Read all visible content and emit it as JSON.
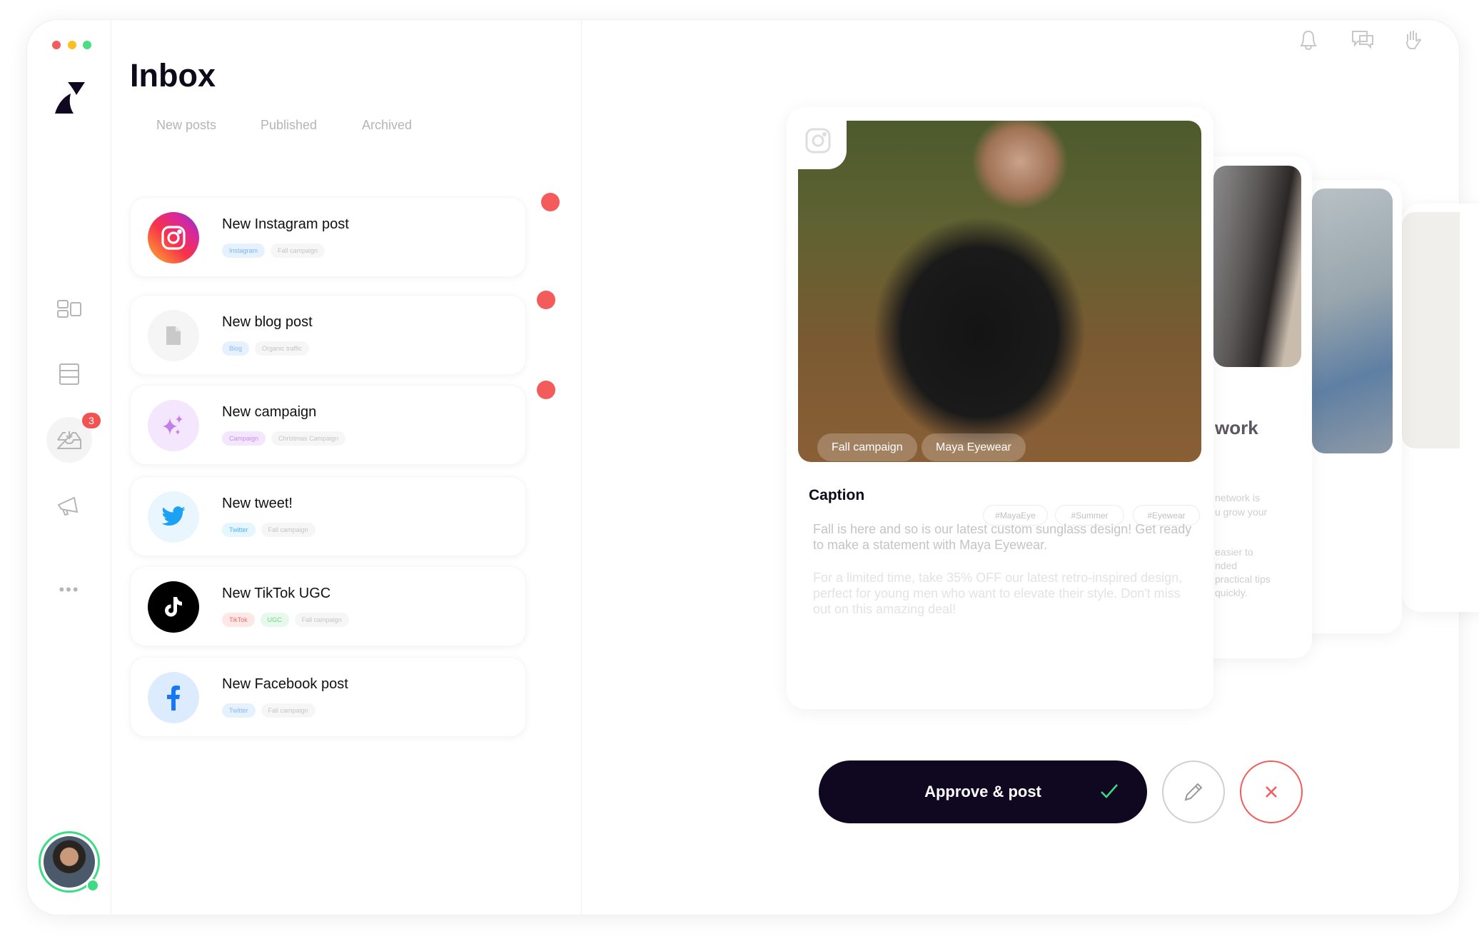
{
  "sidebar": {
    "badge_count": "3",
    "nav": [
      "dashboard",
      "posts",
      "inbox",
      "campaigns",
      "more"
    ]
  },
  "inbox": {
    "title": "Inbox",
    "tabs": [
      "New posts",
      "Published",
      "Archived"
    ],
    "items": [
      {
        "title": "New Instagram post",
        "icon": "instagram-icon",
        "unread": true,
        "tags": [
          {
            "label": "Instagram",
            "bg": "#e6f1fe",
            "fg": "#7ab6f7"
          },
          {
            "label": "Fall campaign"
          }
        ]
      },
      {
        "title": "New blog post",
        "icon": "document-icon",
        "unread": true,
        "tags": [
          {
            "label": "Blog",
            "bg": "#e6f1fe",
            "fg": "#8ab8ef"
          },
          {
            "label": "Organic traffic"
          }
        ]
      },
      {
        "title": "New campaign",
        "icon": "sparkles-icon",
        "unread": true,
        "tags": [
          {
            "label": "Campaign",
            "bg": "#f3e6fd",
            "fg": "#c58ff0"
          },
          {
            "label": "Christmas Campaign"
          }
        ]
      },
      {
        "title": "New tweet!",
        "icon": "twitter-icon",
        "unread": false,
        "tags": [
          {
            "label": "Twitter",
            "bg": "#e6f6fe",
            "fg": "#4fb3f1"
          },
          {
            "label": "Fall campaign"
          }
        ]
      },
      {
        "title": "New TikTok UGC",
        "icon": "tiktok-icon",
        "unread": false,
        "tags": [
          {
            "label": "TikTok",
            "bg": "#fde8e8",
            "fg": "#f26b6b"
          },
          {
            "label": "UGC",
            "bg": "#e6f9ec",
            "fg": "#6fd48f"
          },
          {
            "label": "Fall campaign"
          }
        ]
      },
      {
        "title": "New Facebook post",
        "icon": "facebook-icon",
        "unread": false,
        "tags": [
          {
            "label": "Twitter",
            "bg": "#e6f1fe",
            "fg": "#8ab8ef"
          },
          {
            "label": "Fall campaign"
          }
        ]
      }
    ]
  },
  "header_icons": [
    "bell-icon",
    "chat-icon",
    "hand-wave-icon"
  ],
  "preview": {
    "image_tags": [
      "Fall campaign",
      "Maya Eyewear"
    ],
    "caption_label": "Caption",
    "hashtags": [
      "#MayaEye",
      "#Summer",
      "#Eyewear"
    ],
    "caption_p1": "Fall is here and so is our latest custom sunglass design! Get ready to make a statement with Maya Eyewear.",
    "caption_p2": "For a limited time, take 35% OFF our latest retro-inspired design, perfect for young men who want to elevate their style. Don't miss out on this amazing deal!",
    "back_card_title": "work",
    "back_card_text1": "network is\nu grow your",
    "back_card_text2": "easier to\nnded\npractical tips\nquickly."
  },
  "actions": {
    "approve_label": "Approve & post"
  },
  "colors": {
    "accent": "#0f0820",
    "unread": "#f45b5b",
    "online": "#3ddc84"
  }
}
